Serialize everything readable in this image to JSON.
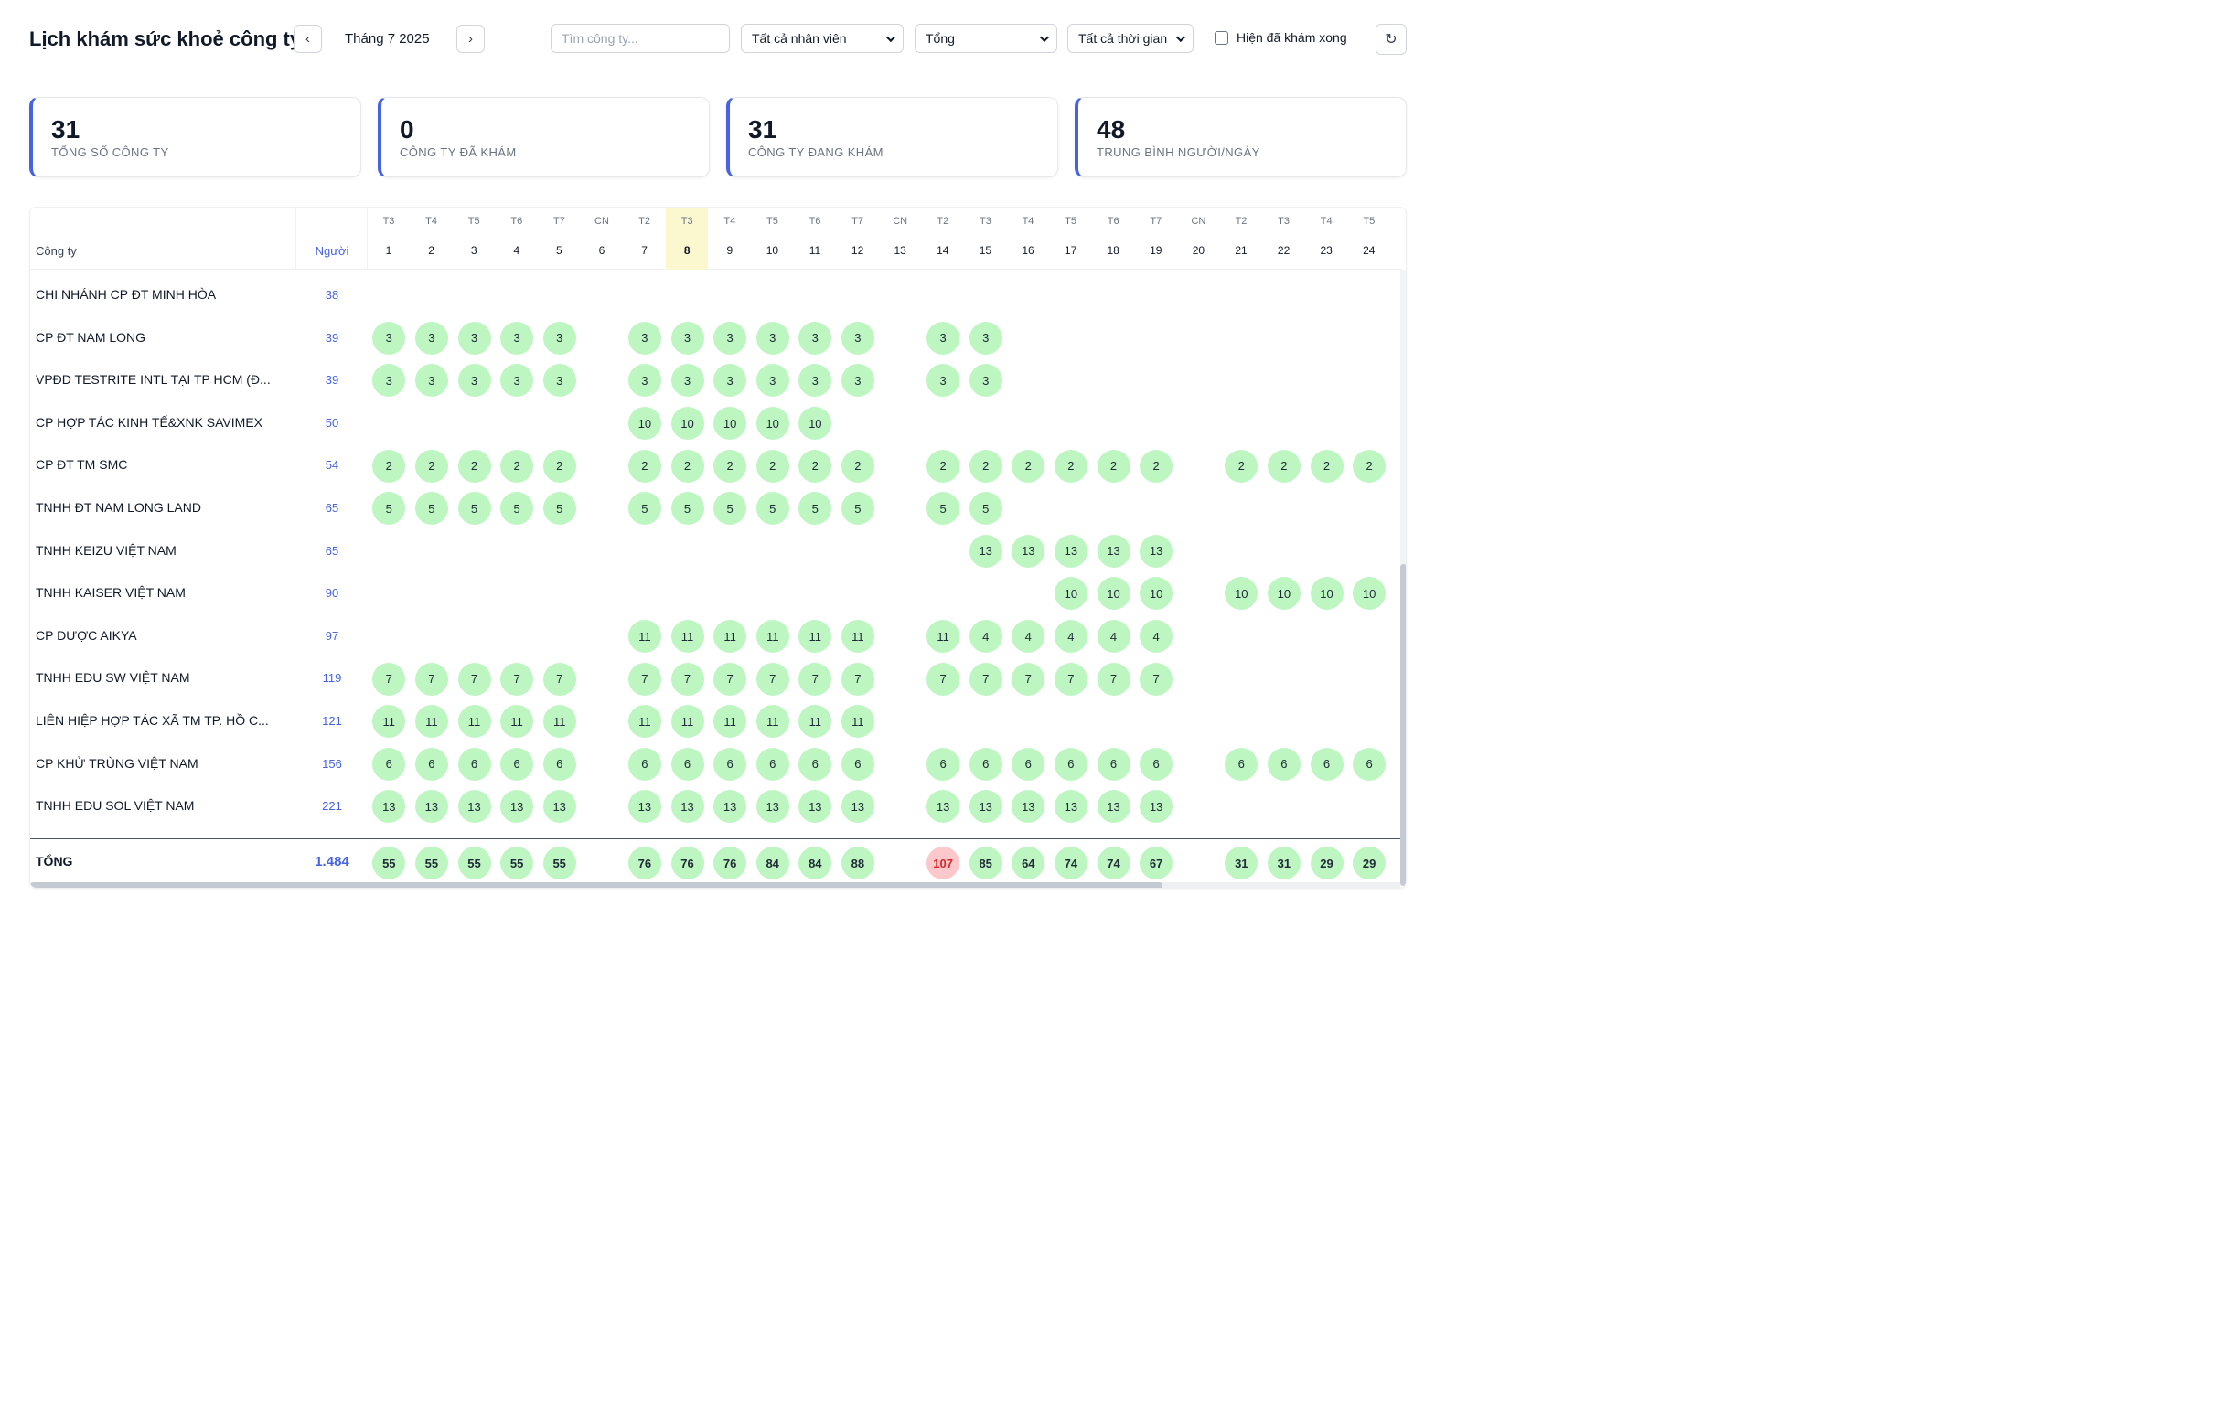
{
  "header": {
    "title": "Lịch khám sức khoẻ công ty",
    "prev_label": "‹",
    "next_label": "›",
    "month": "Tháng 7 2025",
    "search_placeholder": "Tìm công ty...",
    "employee_filter": "Tất cả nhân viên",
    "view_filter": "Tổng",
    "time_filter": "Tất cả thời gian",
    "show_done_label": "Hiện đã khám xong",
    "show_done_checked": false,
    "refresh_label": "↻"
  },
  "stats": [
    {
      "value": "31",
      "label": "TỔNG SỐ CÔNG TY"
    },
    {
      "value": "0",
      "label": "CÔNG TY ĐÃ KHÁM"
    },
    {
      "value": "31",
      "label": "CÔNG TY ĐANG KHÁM"
    },
    {
      "value": "48",
      "label": "TRUNG BÌNH NGƯỜI/NGÀY"
    }
  ],
  "table": {
    "company_header": "Công ty",
    "people_header": "Người",
    "today_day": 8,
    "days": [
      {
        "dow": "T3",
        "day": "1"
      },
      {
        "dow": "T4",
        "day": "2"
      },
      {
        "dow": "T5",
        "day": "3"
      },
      {
        "dow": "T6",
        "day": "4"
      },
      {
        "dow": "T7",
        "day": "5"
      },
      {
        "dow": "CN",
        "day": "6"
      },
      {
        "dow": "T2",
        "day": "7"
      },
      {
        "dow": "T3",
        "day": "8"
      },
      {
        "dow": "T4",
        "day": "9"
      },
      {
        "dow": "T5",
        "day": "10"
      },
      {
        "dow": "T6",
        "day": "11"
      },
      {
        "dow": "T7",
        "day": "12"
      },
      {
        "dow": "CN",
        "day": "13"
      },
      {
        "dow": "T2",
        "day": "14"
      },
      {
        "dow": "T3",
        "day": "15"
      },
      {
        "dow": "T4",
        "day": "16"
      },
      {
        "dow": "T5",
        "day": "17"
      },
      {
        "dow": "T6",
        "day": "18"
      },
      {
        "dow": "T7",
        "day": "19"
      },
      {
        "dow": "CN",
        "day": "20"
      },
      {
        "dow": "T2",
        "day": "21"
      },
      {
        "dow": "T3",
        "day": "22"
      },
      {
        "dow": "T4",
        "day": "23"
      },
      {
        "dow": "T5",
        "day": "24"
      }
    ],
    "rows": [
      {
        "name": "CHI NHÁNH CP ĐT MINH HÒA",
        "people": "38",
        "cells": [
          "",
          "",
          "",
          "",
          "",
          "",
          "",
          "",
          "",
          "",
          "",
          "",
          "",
          "",
          "",
          "",
          "",
          "",
          "",
          "",
          "",
          "",
          "",
          ""
        ]
      },
      {
        "name": "CP ĐT NAM LONG",
        "people": "39",
        "cells": [
          "3",
          "3",
          "3",
          "3",
          "3",
          "",
          "3",
          "3",
          "3",
          "3",
          "3",
          "3",
          "",
          "3",
          "3",
          "",
          "",
          "",
          "",
          "",
          "",
          "",
          "",
          ""
        ]
      },
      {
        "name": "VPĐD TESTRITE INTL TẠI TP HCM (Đ...",
        "people": "39",
        "cells": [
          "3",
          "3",
          "3",
          "3",
          "3",
          "",
          "3",
          "3",
          "3",
          "3",
          "3",
          "3",
          "",
          "3",
          "3",
          "",
          "",
          "",
          "",
          "",
          "",
          "",
          "",
          ""
        ]
      },
      {
        "name": "CP HỢP TÁC KINH TẾ&XNK SAVIMEX",
        "people": "50",
        "cells": [
          "",
          "",
          "",
          "",
          "",
          "",
          "10",
          "10",
          "10",
          "10",
          "10",
          "",
          "",
          "",
          "",
          "",
          "",
          "",
          "",
          "",
          "",
          "",
          "",
          ""
        ]
      },
      {
        "name": "CP ĐT TM SMC",
        "people": "54",
        "cells": [
          "2",
          "2",
          "2",
          "2",
          "2",
          "",
          "2",
          "2",
          "2",
          "2",
          "2",
          "2",
          "",
          "2",
          "2",
          "2",
          "2",
          "2",
          "2",
          "",
          "2",
          "2",
          "2",
          "2"
        ]
      },
      {
        "name": "TNHH ĐT NAM LONG LAND",
        "people": "65",
        "cells": [
          "5",
          "5",
          "5",
          "5",
          "5",
          "",
          "5",
          "5",
          "5",
          "5",
          "5",
          "5",
          "",
          "5",
          "5",
          "",
          "",
          "",
          "",
          "",
          "",
          "",
          "",
          ""
        ]
      },
      {
        "name": "TNHH KEIZU VIỆT NAM",
        "people": "65",
        "cells": [
          "",
          "",
          "",
          "",
          "",
          "",
          "",
          "",
          "",
          "",
          "",
          "",
          "",
          "",
          "13",
          "13",
          "13",
          "13",
          "13",
          "",
          "",
          "",
          "",
          ""
        ]
      },
      {
        "name": "TNHH KAISER VIỆT NAM",
        "people": "90",
        "cells": [
          "",
          "",
          "",
          "",
          "",
          "",
          "",
          "",
          "",
          "",
          "",
          "",
          "",
          "",
          "",
          "",
          "10",
          "10",
          "10",
          "",
          "10",
          "10",
          "10",
          "10"
        ]
      },
      {
        "name": "CP DƯỢC AIKYA",
        "people": "97",
        "cells": [
          "",
          "",
          "",
          "",
          "",
          "",
          "11",
          "11",
          "11",
          "11",
          "11",
          "11",
          "",
          "11",
          "4",
          "4",
          "4",
          "4",
          "4",
          "",
          "",
          "",
          "",
          ""
        ]
      },
      {
        "name": "TNHH EDU SW VIỆT NAM",
        "people": "119",
        "cells": [
          "7",
          "7",
          "7",
          "7",
          "7",
          "",
          "7",
          "7",
          "7",
          "7",
          "7",
          "7",
          "",
          "7",
          "7",
          "7",
          "7",
          "7",
          "7",
          "",
          "",
          "",
          "",
          ""
        ]
      },
      {
        "name": "LIÊN HIỆP HỢP TÁC XÃ TM TP. HỒ C...",
        "people": "121",
        "cells": [
          "11",
          "11",
          "11",
          "11",
          "11",
          "",
          "11",
          "11",
          "11",
          "11",
          "11",
          "11",
          "",
          "",
          "",
          "",
          "",
          "",
          "",
          "",
          "",
          "",
          "",
          ""
        ]
      },
      {
        "name": "CP KHỬ TRÙNG VIỆT NAM",
        "people": "156",
        "cells": [
          "6",
          "6",
          "6",
          "6",
          "6",
          "",
          "6",
          "6",
          "6",
          "6",
          "6",
          "6",
          "",
          "6",
          "6",
          "6",
          "6",
          "6",
          "6",
          "",
          "6",
          "6",
          "6",
          "6"
        ]
      },
      {
        "name": "TNHH EDU SOL VIỆT NAM",
        "people": "221",
        "cells": [
          "13",
          "13",
          "13",
          "13",
          "13",
          "",
          "13",
          "13",
          "13",
          "13",
          "13",
          "13",
          "",
          "13",
          "13",
          "13",
          "13",
          "13",
          "13",
          "",
          "",
          "",
          "",
          ""
        ]
      }
    ],
    "total": {
      "label": "TỔNG",
      "people": "1.484",
      "cells": [
        "55",
        "55",
        "55",
        "55",
        "55",
        "",
        "76",
        "76",
        "76",
        "84",
        "84",
        "88",
        "",
        "107",
        "85",
        "64",
        "74",
        "74",
        "67",
        "",
        "31",
        "31",
        "29",
        "29"
      ],
      "alert_day": 14
    }
  },
  "colors": {
    "accent": "#4563e4",
    "cell_green": "#bdf6c1",
    "alert_red": "#fcc8cc",
    "today_yellow": "#fbf7cf"
  }
}
